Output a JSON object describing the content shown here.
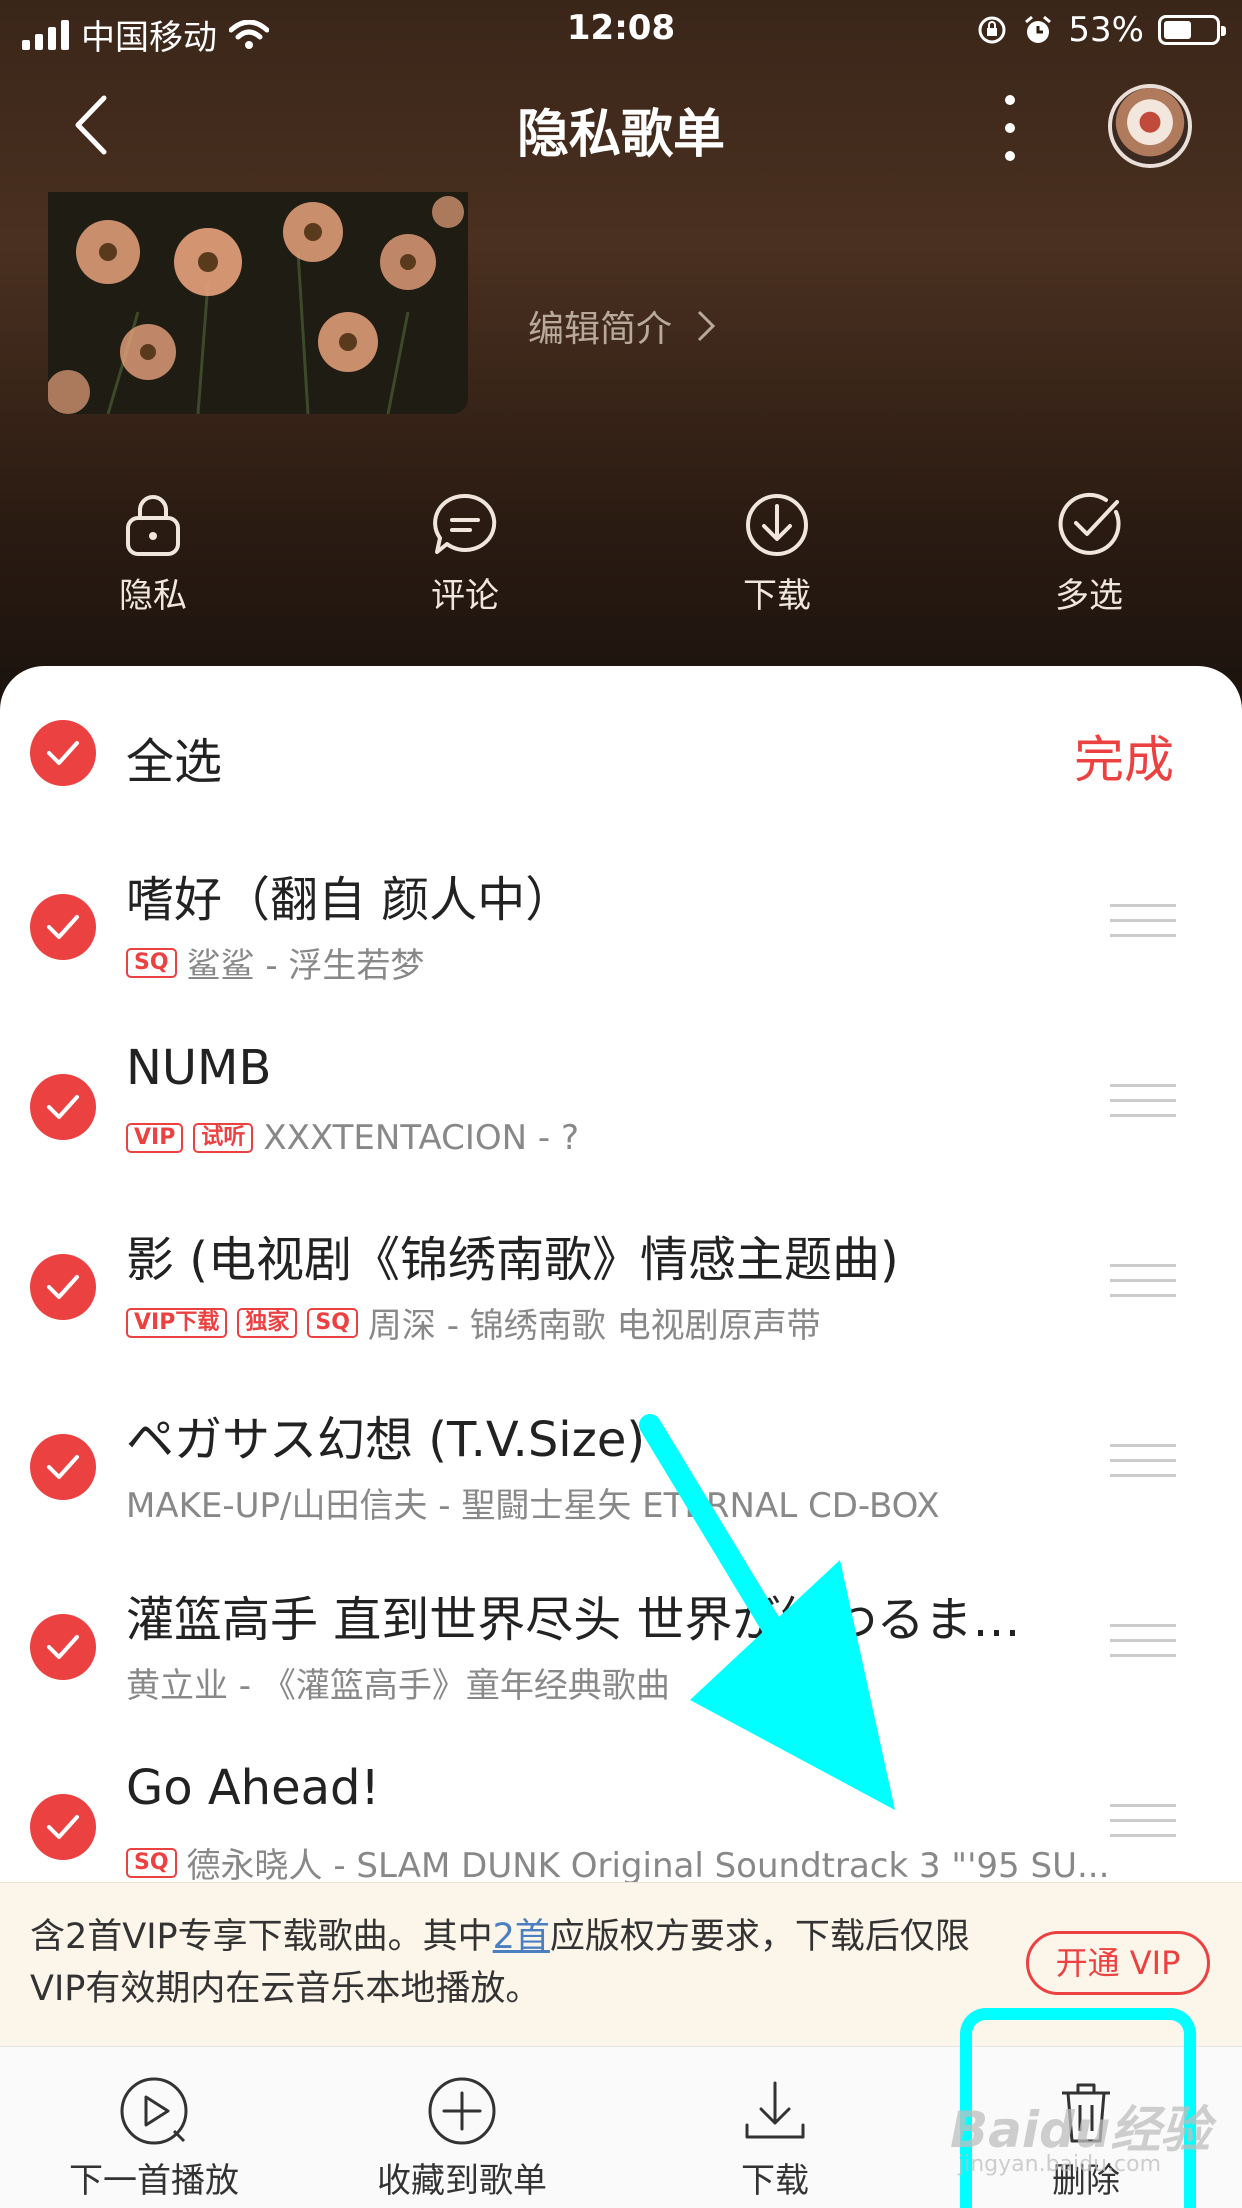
{
  "status_bar": {
    "carrier": "中国移动",
    "time": "12:08",
    "battery_percent": "53%",
    "battery_level": 0.53
  },
  "nav": {
    "title": "隐私歌单"
  },
  "playlist": {
    "edit_intro": "编辑简介"
  },
  "actions": [
    {
      "label": "隐私",
      "icon": "lock-icon"
    },
    {
      "label": "评论",
      "icon": "comment-icon"
    },
    {
      "label": "下载",
      "icon": "download-icon"
    },
    {
      "label": "多选",
      "icon": "multi-select-icon"
    }
  ],
  "selection": {
    "select_all_label": "全选",
    "done_label": "完成"
  },
  "songs": [
    {
      "title": "嗜好（翻自 颜人中）",
      "tags": [
        "SQ"
      ],
      "subtitle": "鲨鲨 - 浮生若梦"
    },
    {
      "title": "NUMB",
      "tags": [
        "VIP",
        "试听"
      ],
      "subtitle": "XXXTENTACION - ?"
    },
    {
      "title": "影 (电视剧《锦绣南歌》情感主题曲)",
      "tags": [
        "VIP下载",
        "独家",
        "SQ"
      ],
      "subtitle": "周深 - 锦绣南歌 电视剧原声带"
    },
    {
      "title": "ペガサス幻想 (T.V.Size)",
      "tags": [],
      "subtitle": "MAKE-UP/山田信夫 - 聖闘士星矢 ETERNAL CD-BOX"
    },
    {
      "title": "灌篮高手 直到世界尽头 世界が終わるま…",
      "tags": [],
      "subtitle": "黄立业 - 《灌篮高手》童年经典歌曲"
    },
    {
      "title": "Go Ahead!",
      "tags": [
        "SQ"
      ],
      "subtitle": "德永晓人 - SLAM DUNK Original Soundtrack 3 \"'95 SU..."
    }
  ],
  "vip_notice": {
    "text_before": "含2首VIP专享下载歌曲。其中",
    "link": "2首",
    "text_after": "应版权方要求，下载后仅限VIP有效期内在云音乐本地播放。",
    "button": "开通 VIP"
  },
  "toolbar": [
    {
      "label": "下一首播放",
      "icon": "play-next-icon"
    },
    {
      "label": "收藏到歌单",
      "icon": "add-to-playlist-icon"
    },
    {
      "label": "下载",
      "icon": "download-icon"
    },
    {
      "label": "删除",
      "icon": "trash-icon"
    }
  ],
  "watermark": {
    "brand": "Baidu经验",
    "url": "jingyan.baidu.com"
  },
  "colors": {
    "accent": "#ec4141",
    "annotation": "#00ffff",
    "vip_bar_bg": "#fbf5ea"
  }
}
